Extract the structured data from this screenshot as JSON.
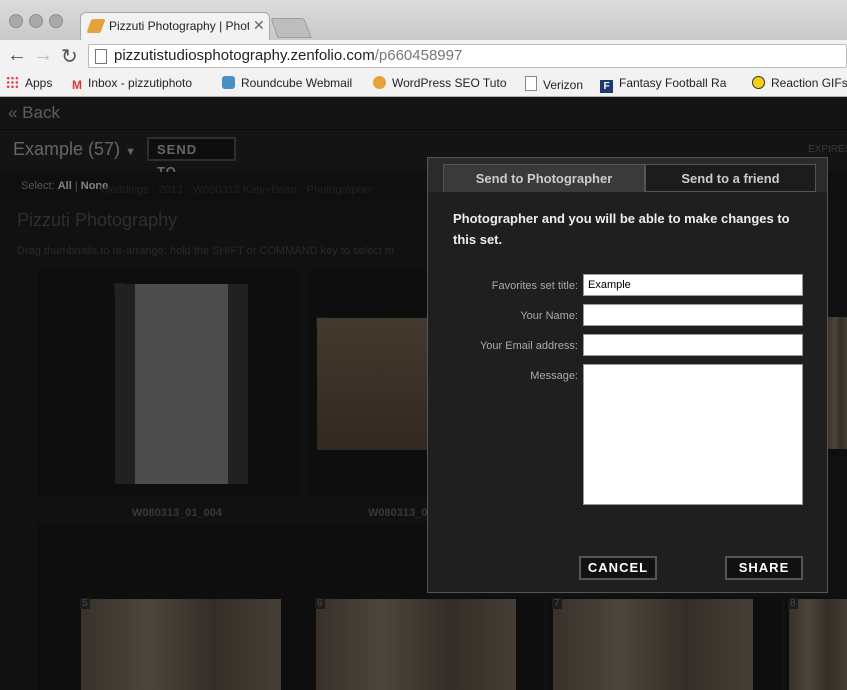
{
  "browser": {
    "tab_title": "Pizzuti Photography | Photo",
    "url_host": "pizzutistudiosphotography.zenfolio.com",
    "url_path": "/p660458997",
    "bookmarks": [
      {
        "label": "Apps"
      },
      {
        "label": "Inbox - pizzutiphoto"
      },
      {
        "label": "Roundcube Webmail"
      },
      {
        "label": "WordPress SEO Tuto"
      },
      {
        "label": "Verizon"
      },
      {
        "label": "Fantasy Football Ra"
      },
      {
        "label": "Reaction GIFs"
      }
    ]
  },
  "page": {
    "back_label": "« Back",
    "set_title": "Example (57)",
    "send_to_label": "SEND TO...",
    "expires_label": "EXPIRES",
    "select_label": "Select:",
    "select_all": "All",
    "select_none": "None",
    "breadcrumb": "Weddings · 2013 · W080313 Katy+Brian · Photographer",
    "site_title": "Pizzuti Photography",
    "hint": "Drag thumbnails to re-arrange; hold the SHIFT or COMMAND key to select m",
    "thumbnails": [
      {
        "num": "1",
        "caption": "W080313_01_004"
      },
      {
        "num": "2",
        "caption": "W080313_0"
      },
      {
        "num": "5",
        "caption": ""
      },
      {
        "num": "6",
        "caption": ""
      },
      {
        "num": "7",
        "caption": ""
      },
      {
        "num": "8",
        "caption": ""
      }
    ]
  },
  "dialog": {
    "tab_photographer": "Send to Photographer",
    "tab_friend": "Send to a friend",
    "message": "Photographer and you will be able to make changes to this set.",
    "fields": {
      "title_label": "Favorites set title:",
      "title_value": "Example",
      "name_label": "Your Name:",
      "name_value": "",
      "email_label": "Your Email address:",
      "email_value": "",
      "message_label": "Message:",
      "message_value": ""
    },
    "cancel_label": "CANCEL",
    "share_label": "SHARE"
  }
}
